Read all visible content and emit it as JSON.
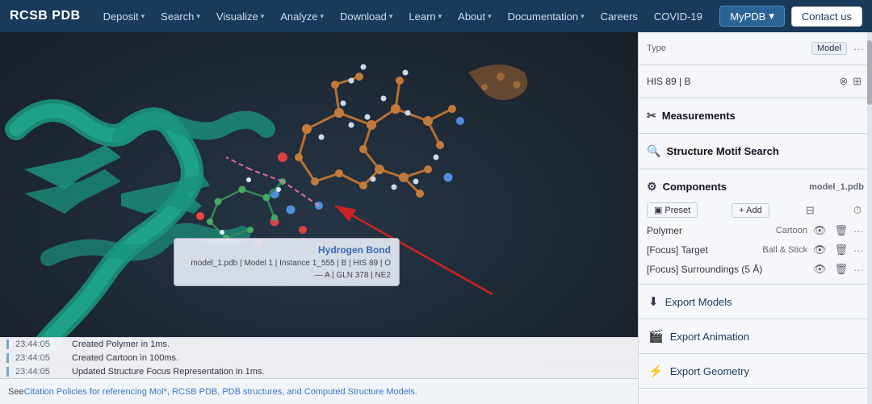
{
  "navbar": {
    "brand": "RCSB PDB",
    "items": [
      {
        "label": "Deposit",
        "hasDropdown": true
      },
      {
        "label": "Search",
        "hasDropdown": true
      },
      {
        "label": "Visualize",
        "hasDropdown": true
      },
      {
        "label": "Analyze",
        "hasDropdown": true
      },
      {
        "label": "Download",
        "hasDropdown": true
      },
      {
        "label": "Learn",
        "hasDropdown": true
      },
      {
        "label": "About",
        "hasDropdown": true
      },
      {
        "label": "Documentation",
        "hasDropdown": true
      },
      {
        "label": "Careers",
        "hasDropdown": false
      },
      {
        "label": "COVID-19",
        "hasDropdown": false
      }
    ],
    "mypdb_label": "MyPDB",
    "contact_label": "Contact us"
  },
  "right_panel": {
    "type_label": "Type",
    "type_value": "Model",
    "his_label": "HIS 89 | B",
    "measurements_label": "Measurements",
    "structure_motif_label": "Structure Motif Search",
    "components_label": "Components",
    "components_file": "model_1.pdb",
    "preset_label": "Preset",
    "add_label": "+ Add",
    "polymer_label": "Polymer",
    "polymer_style": "Cartoon",
    "focus_target_label": "[Focus] Target",
    "focus_target_style": "Ball & Stick",
    "focus_surroundings_label": "[Focus] Surroundings (5 Å)",
    "export_models_label": "Export Models",
    "export_animation_label": "Export Animation",
    "export_geometry_label": "Export Geometry"
  },
  "log": {
    "rows": [
      {
        "time": "23:44:05",
        "message": "Created Polymer in 1ms."
      },
      {
        "time": "23:44:05",
        "message": "Created Cartoon in 100ms."
      },
      {
        "time": "23:44:05",
        "message": "Updated Structure Focus Representation in 1ms."
      }
    ]
  },
  "tooltip": {
    "title": "Hydrogen Bond",
    "detail": "model_1.pdb | Model 1 | Instance 1_555 | B | HIS 89 | O — A | GLN 378 | NE2"
  },
  "footer": {
    "prefix": "See ",
    "link_text": "Citation Policies for referencing Mol*, RCSB PDB, PDB structures, and Computed Structure Models.",
    "link_href": "#"
  }
}
